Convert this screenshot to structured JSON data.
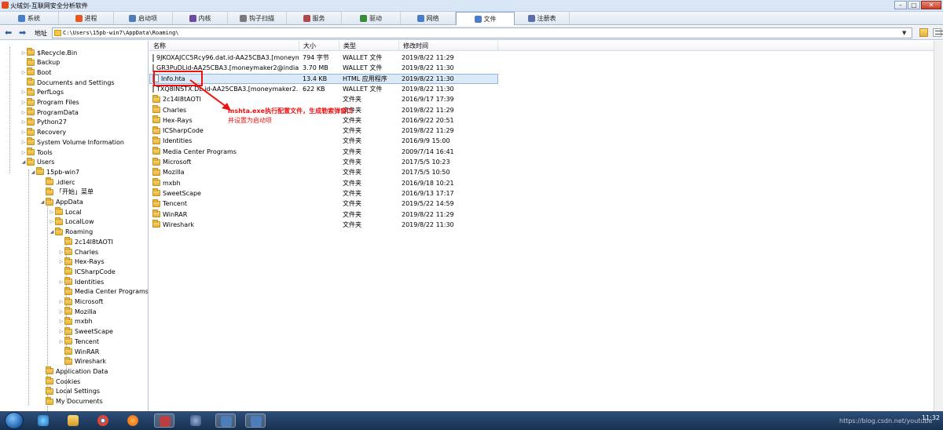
{
  "window": {
    "title": "火绒剑-互联网安全分析软件",
    "controls": [
      "–",
      "□",
      "✕"
    ]
  },
  "tabs": [
    {
      "label": "系统",
      "icon": "monitor-icon",
      "color": "#4a7cc7",
      "active": false
    },
    {
      "label": "进程",
      "icon": "windows-flag-icon",
      "color": "#e35b20",
      "active": false
    },
    {
      "label": "启动项",
      "icon": "gear-icon",
      "color": "#4d7db8",
      "active": false
    },
    {
      "label": "内核",
      "icon": "kernel-icon",
      "color": "#6b4aa0",
      "active": false
    },
    {
      "label": "钩子扫描",
      "icon": "hook-icon",
      "color": "#7a7a7a",
      "active": false
    },
    {
      "label": "服务",
      "icon": "service-icon",
      "color": "#b04a4a",
      "active": false
    },
    {
      "label": "驱动",
      "icon": "driver-icon",
      "color": "#3c8a3c",
      "active": false
    },
    {
      "label": "网络",
      "icon": "network-icon",
      "color": "#4a7cc7",
      "active": false
    },
    {
      "label": "文件",
      "icon": "file-icon",
      "color": "#4a7cc7",
      "active": true
    },
    {
      "label": "注册表",
      "icon": "registry-icon",
      "color": "#5a6fa8",
      "active": false
    }
  ],
  "address": {
    "label": "地址",
    "path": "C:\\Users\\15pb-win7\\AppData\\Roaming\\",
    "dropdown": "▼"
  },
  "tree": {
    "items": [
      {
        "label": "$Recycle.Bin",
        "toggle": "▷"
      },
      {
        "label": "Backup",
        "toggle": ""
      },
      {
        "label": "Boot",
        "toggle": "▷"
      },
      {
        "label": "Documents and Settings",
        "toggle": ""
      },
      {
        "label": "PerfLogs",
        "toggle": "▷"
      },
      {
        "label": "Program Files",
        "toggle": "▷"
      },
      {
        "label": "ProgramData",
        "toggle": "▷"
      },
      {
        "label": "Python27",
        "toggle": "▷"
      },
      {
        "label": "Recovery",
        "toggle": "▷"
      },
      {
        "label": "System Volume Information",
        "toggle": "▷"
      },
      {
        "label": "Tools",
        "toggle": "▷"
      },
      {
        "label": "Users",
        "toggle": "◢"
      },
      {
        "label": "15pb-win7",
        "toggle": "◢"
      },
      {
        "label": ".idlerc",
        "toggle": ""
      },
      {
        "label": "「开始」菜单",
        "toggle": ""
      },
      {
        "label": "AppData",
        "toggle": "◢"
      },
      {
        "label": "Local",
        "toggle": "▷"
      },
      {
        "label": "LocalLow",
        "toggle": "▷"
      },
      {
        "label": "Roaming",
        "toggle": "◢"
      },
      {
        "label": "2c14l8tAOTI",
        "toggle": ""
      },
      {
        "label": "Charles",
        "toggle": "▷"
      },
      {
        "label": "Hex-Rays",
        "toggle": "▷"
      },
      {
        "label": "ICSharpCode",
        "toggle": ""
      },
      {
        "label": "Identities",
        "toggle": "▷"
      },
      {
        "label": "Media Center Programs",
        "toggle": ""
      },
      {
        "label": "Microsoft",
        "toggle": "▷"
      },
      {
        "label": "Mozilla",
        "toggle": "▷"
      },
      {
        "label": "mxbh",
        "toggle": "▷"
      },
      {
        "label": "SweetScape",
        "toggle": "▷"
      },
      {
        "label": "Tencent",
        "toggle": "▷"
      },
      {
        "label": "WinRAR",
        "toggle": ""
      },
      {
        "label": "Wireshark",
        "toggle": ""
      },
      {
        "label": "Application Data",
        "toggle": ""
      },
      {
        "label": "Cookies",
        "toggle": ""
      },
      {
        "label": "Local Settings",
        "toggle": ""
      },
      {
        "label": "My Documents",
        "toggle": ""
      }
    ]
  },
  "list": {
    "columns": [
      "名称",
      "大小",
      "类型",
      "修改时间"
    ],
    "rows": [
      {
        "name": "9JKOXAJCC5Rcy96.dat.id-AA25CBA3.[moneym...",
        "size": "794 字节",
        "type": "WALLET 文件",
        "time": "2019/8/22 11:29",
        "kind": "file"
      },
      {
        "name": "GR3PuDLid-AA25CBA3.[moneymaker2@india...",
        "size": "3.70 MB",
        "type": "WALLET 文件",
        "time": "2019/8/22 11:30",
        "kind": "file"
      },
      {
        "name": "Info.hta",
        "size": "13.4 KB",
        "type": "HTML 应用程序",
        "time": "2019/8/22 11:30",
        "kind": "file"
      },
      {
        "name": "TXQ8INSTX.DL.id-AA25CBA3.[moneymaker2...",
        "size": "622 KB",
        "type": "WALLET 文件",
        "time": "2019/8/22 11:30",
        "kind": "file"
      },
      {
        "name": "2c14l8tAOTI",
        "size": "",
        "type": "文件夹",
        "time": "2016/9/17 17:39",
        "kind": "folder"
      },
      {
        "name": "Charles",
        "size": "",
        "type": "文件夹",
        "time": "2019/8/22 11:29",
        "kind": "folder"
      },
      {
        "name": "Hex-Rays",
        "size": "",
        "type": "文件夹",
        "time": "2016/9/22 20:51",
        "kind": "folder"
      },
      {
        "name": "ICSharpCode",
        "size": "",
        "type": "文件夹",
        "time": "2019/8/22 11:29",
        "kind": "folder"
      },
      {
        "name": "Identities",
        "size": "",
        "type": "文件夹",
        "time": "2016/9/9 15:00",
        "kind": "folder"
      },
      {
        "name": "Media Center Programs",
        "size": "",
        "type": "文件夹",
        "time": "2009/7/14 16:41",
        "kind": "folder"
      },
      {
        "name": "Microsoft",
        "size": "",
        "type": "文件夹",
        "time": "2017/5/5 10:23",
        "kind": "folder"
      },
      {
        "name": "Mozilla",
        "size": "",
        "type": "文件夹",
        "time": "2017/5/5 10:50",
        "kind": "folder"
      },
      {
        "name": "mxbh",
        "size": "",
        "type": "文件夹",
        "time": "2016/9/18 10:21",
        "kind": "folder"
      },
      {
        "name": "SweetScape",
        "size": "",
        "type": "文件夹",
        "time": "2016/9/13 17:17",
        "kind": "folder"
      },
      {
        "name": "Tencent",
        "size": "",
        "type": "文件夹",
        "time": "2019/5/22 14:59",
        "kind": "folder"
      },
      {
        "name": "WinRAR",
        "size": "",
        "type": "文件夹",
        "time": "2019/8/22 11:29",
        "kind": "folder"
      },
      {
        "name": "Wireshark",
        "size": "",
        "type": "文件夹",
        "time": "2019/8/22 11:30",
        "kind": "folder"
      }
    ],
    "selected_name": "Info.hta"
  },
  "annotation": {
    "line1": "mshta.exe执行配置文件，生成勒索弹窗口",
    "line2": "并设置为启动项",
    "color": "#e11111"
  },
  "taskbar": {
    "clock": "11:32",
    "watermark": "https://blog.csdn.net/youtube"
  }
}
